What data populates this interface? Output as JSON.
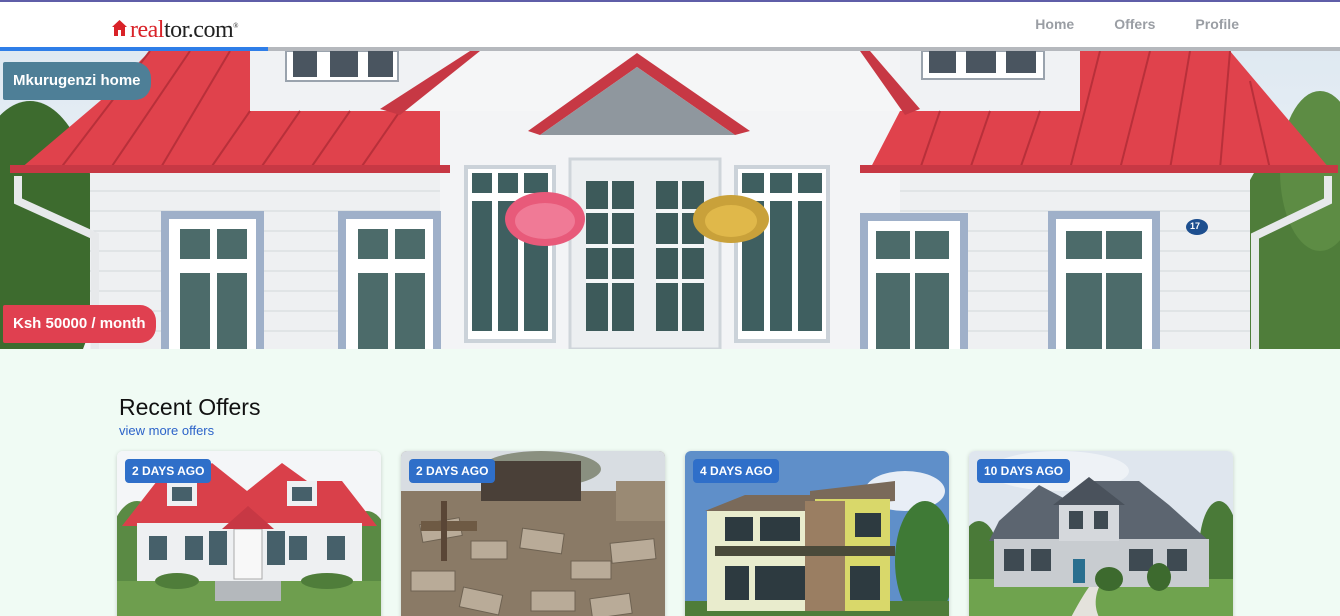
{
  "brand": {
    "name_part1": "real",
    "name_part2": "tor.com",
    "trademark": "®",
    "logo_icon": "house-icon",
    "colors": {
      "brand_red": "#d92228",
      "nav_text": "#9a9ea4"
    }
  },
  "nav": {
    "items": [
      {
        "label": "Home"
      },
      {
        "label": "Offers"
      },
      {
        "label": "Profile"
      }
    ]
  },
  "progress": {
    "value_percent": 20
  },
  "hero": {
    "property_name": "Mkurugenzi home",
    "price": "Ksh 50000 / month",
    "house_number": "17",
    "colors": {
      "name_badge": "#4e7f97",
      "price_badge": "#e04050",
      "roof": "#e0424c"
    }
  },
  "recent_offers": {
    "title": "Recent Offers",
    "view_more": "view more offers",
    "offers": [
      {
        "age": "2 DAYS AGO",
        "image": "house-red-roof"
      },
      {
        "age": "2 DAYS AGO",
        "image": "construction-site"
      },
      {
        "age": "4 DAYS AGO",
        "image": "modern-house"
      },
      {
        "age": "10 DAYS AGO",
        "image": "grey-house"
      }
    ],
    "colors": {
      "age_badge": "#2f6fc9",
      "link": "#2c63c9"
    }
  }
}
